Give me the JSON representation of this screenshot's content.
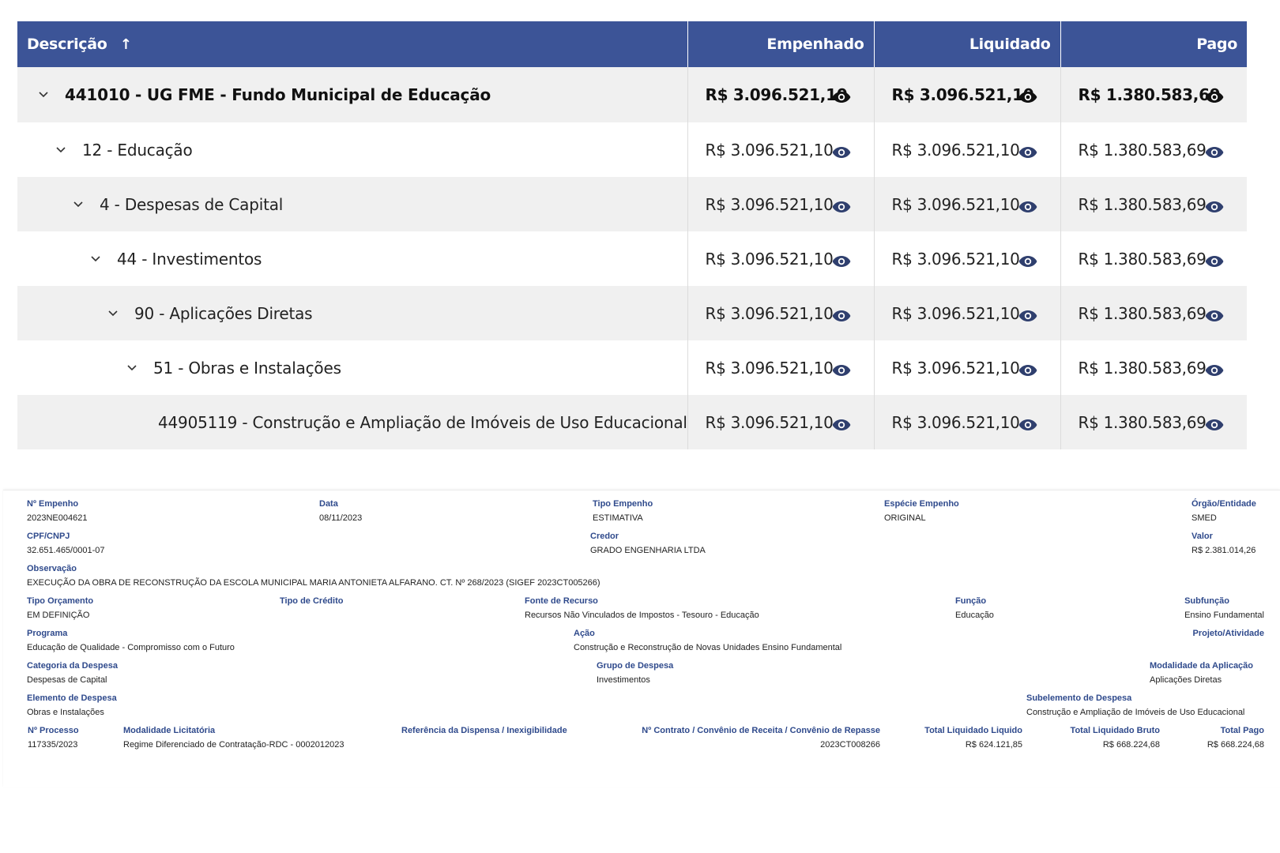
{
  "table": {
    "headers": {
      "descricao": "Descrição",
      "sort_arrow": "↑",
      "empenhado": "Empenhado",
      "liquidado": "Liquidado",
      "pago": "Pago"
    },
    "rows": [
      {
        "label": "441010 - UG FME - Fundo Municipal de Educação",
        "empenhado": "R$ 3.096.521,10",
        "liquidado": "R$ 3.096.521,10",
        "pago": "R$ 1.380.583,69",
        "expand": "⌄"
      },
      {
        "label": "12 - Educação",
        "empenhado": "R$ 3.096.521,10",
        "liquidado": "R$ 3.096.521,10",
        "pago": "R$ 1.380.583,69",
        "expand": "⌄"
      },
      {
        "label": "4 - Despesas de Capital",
        "empenhado": "R$ 3.096.521,10",
        "liquidado": "R$ 3.096.521,10",
        "pago": "R$ 1.380.583,69",
        "expand": "⌄"
      },
      {
        "label": "44 - Investimentos",
        "empenhado": "R$ 3.096.521,10",
        "liquidado": "R$ 3.096.521,10",
        "pago": "R$ 1.380.583,69",
        "expand": "⌄"
      },
      {
        "label": "90 - Aplicações Diretas",
        "empenhado": "R$ 3.096.521,10",
        "liquidado": "R$ 3.096.521,10",
        "pago": "R$ 1.380.583,69",
        "expand": "⌄"
      },
      {
        "label": "51 - Obras e Instalações",
        "empenhado": "R$ 3.096.521,10",
        "liquidado": "R$ 3.096.521,10",
        "pago": "R$ 1.380.583,69",
        "expand": "⌄"
      },
      {
        "label": "44905119 - Construção e Ampliação de Imóveis de Uso Educacional",
        "empenhado": "R$ 3.096.521,10",
        "liquidado": "R$ 3.096.521,10",
        "pago": "R$ 1.380.583,69",
        "expand": ""
      }
    ]
  },
  "details": {
    "n_empenho": {
      "label": "Nº Empenho",
      "value": "2023NE004621"
    },
    "data": {
      "label": "Data",
      "value": "08/11/2023"
    },
    "tipo_empenho": {
      "label": "Tipo Empenho",
      "value": "ESTIMATIVA"
    },
    "especie_empenho": {
      "label": "Espécie Empenho",
      "value": "ORIGINAL"
    },
    "orgao_entidade": {
      "label": "Órgão/Entidade",
      "value": "SMED"
    },
    "cpf_cnpj": {
      "label": "CPF/CNPJ",
      "value": "32.651.465/0001-07"
    },
    "credor": {
      "label": "Credor",
      "value": "GRADO ENGENHARIA LTDA"
    },
    "valor": {
      "label": "Valor",
      "value": "R$ 2.381.014,26"
    },
    "observacao": {
      "label": "Observação",
      "value": "EXECUÇÃO DA OBRA DE RECONSTRUÇÃO DA ESCOLA MUNICIPAL MARIA ANTONIETA ALFARANO. CT. Nº 268/2023 (SIGEF 2023CT005266)"
    },
    "tipo_orcamento": {
      "label": "Tipo Orçamento",
      "value": "EM DEFINIÇÃO"
    },
    "tipo_credito": {
      "label": "Tipo de Crédito",
      "value": ""
    },
    "fonte_recurso": {
      "label": "Fonte de Recurso",
      "value": "Recursos Não Vinculados de Impostos - Tesouro - Educação"
    },
    "funcao": {
      "label": "Função",
      "value": "Educação"
    },
    "subfuncao": {
      "label": "Subfunção",
      "value": "Ensino Fundamental"
    },
    "programa": {
      "label": "Programa",
      "value": "Educação de Qualidade - Compromisso com o Futuro"
    },
    "acao": {
      "label": "Ação",
      "value": "Construção e Reconstrução de Novas Unidades Ensino Fundamental"
    },
    "projeto_atividade": {
      "label": "Projeto/Atividade",
      "value": ""
    },
    "categoria_despesa": {
      "label": "Categoria da Despesa",
      "value": "Despesas de Capital"
    },
    "grupo_despesa": {
      "label": "Grupo de Despesa",
      "value": "Investimentos"
    },
    "modalidade_aplicacao": {
      "label": "Modalidade da Aplicação",
      "value": "Aplicações Diretas"
    },
    "elemento_despesa": {
      "label": "Elemento de Despesa",
      "value": "Obras e Instalações"
    },
    "subelemento_despesa": {
      "label": "Subelemento de Despesa",
      "value": "Construção e Ampliação de Imóveis de Uso Educacional"
    },
    "n_processo": {
      "label": "Nº Processo",
      "value": "117335/2023"
    },
    "modalidade_licitatoria": {
      "label": "Modalidade Licitatória",
      "value": "Regime Diferenciado de Contratação-RDC - 0002012023"
    },
    "referencia_dispensa": {
      "label": "Referência da Dispensa / Inexigibilidade",
      "value": ""
    },
    "n_contrato": {
      "label": "Nº Contrato / Convênio de Receita / Convênio de Repasse",
      "value": "2023CT008266"
    },
    "total_liquidado_liquido": {
      "label": "Total Liquidado Liquido",
      "value": "R$ 624.121,85"
    },
    "total_liquidado_bruto": {
      "label": "Total Liquidado Bruto",
      "value": "R$ 668.224,68"
    },
    "total_pago": {
      "label": "Total Pago",
      "value": "R$ 668.224,68"
    }
  },
  "icons": {
    "eye": "eye-icon",
    "expand": "chevron-down-icon",
    "sort": "arrow-up-icon"
  },
  "colors": {
    "header_bg": "#3c5497",
    "label_blue": "#2f4a8c",
    "row_alt": "#f0f0f0"
  }
}
